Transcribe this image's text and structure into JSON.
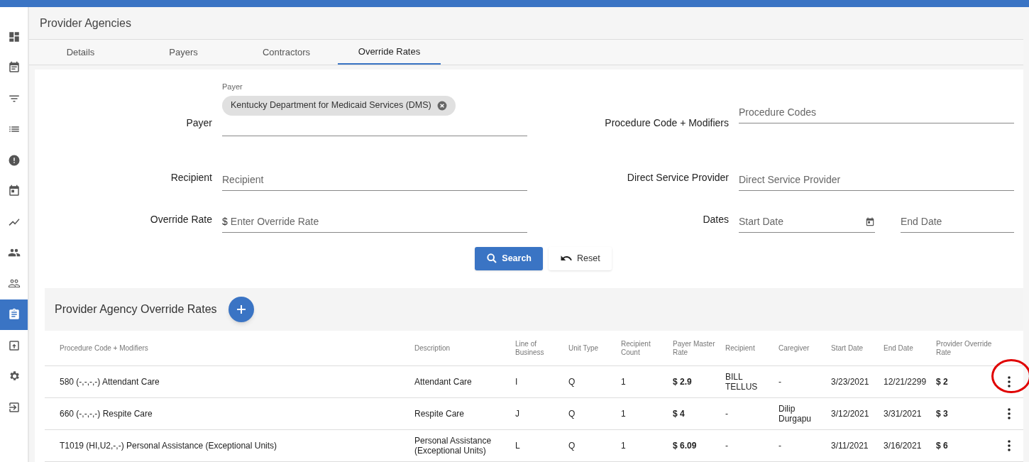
{
  "sidebar": {
    "items": [
      {
        "selected": false
      },
      {
        "selected": false
      },
      {
        "selected": false
      },
      {
        "selected": false
      },
      {
        "selected": false
      },
      {
        "selected": false
      },
      {
        "selected": false
      },
      {
        "selected": false
      },
      {
        "selected": false
      },
      {
        "selected": true
      },
      {
        "selected": false
      },
      {
        "selected": false
      },
      {
        "selected": false
      }
    ]
  },
  "page": {
    "title": "Provider Agencies"
  },
  "tabs": [
    {
      "label": "Details",
      "selected": false
    },
    {
      "label": "Payers",
      "selected": false
    },
    {
      "label": "Contractors",
      "selected": false
    },
    {
      "label": "Override Rates",
      "selected": true
    }
  ],
  "form": {
    "payer": {
      "label": "Payer",
      "floating_label": "Payer",
      "chip": "Kentucky Department for Medicaid Services (DMS)"
    },
    "procedure": {
      "label": "Procedure Code + Modifiers",
      "placeholder": "Procedure Codes"
    },
    "recipient": {
      "label": "Recipient",
      "placeholder": "Recipient"
    },
    "provider": {
      "label": "Direct Service Provider",
      "placeholder": "Direct Service Provider"
    },
    "rate": {
      "label": "Override Rate",
      "prefix": "$",
      "placeholder": "Enter Override Rate"
    },
    "dates": {
      "label": "Dates",
      "start_placeholder": "Start Date",
      "end_placeholder": "End Date"
    },
    "buttons": {
      "search": "Search",
      "reset": "Reset"
    }
  },
  "table": {
    "title": "Provider Agency Override Rates",
    "columns": [
      "Procedure Code + Modifiers",
      "Description",
      "Line of Business",
      "Unit Type",
      "Recipient Count",
      "Payer Master Rate",
      "Recipient",
      "Caregiver",
      "Start Date",
      "End Date",
      "Provider Override Rate"
    ],
    "rows": [
      {
        "highlighted": true,
        "cells": [
          "580 (-,-,-,-) Attendant Care",
          "Attendant Care",
          "I",
          "Q",
          "1",
          "$ 2.9",
          "BILL TELLUS",
          "-",
          "3/23/2021",
          "12/21/2299",
          "$ 2"
        ]
      },
      {
        "highlighted": false,
        "cells": [
          "660 (-,-,-,-) Respite Care",
          "Respite Care",
          "J",
          "Q",
          "1",
          "$ 4",
          "-",
          "Dilip Durgapu",
          "3/12/2021",
          "3/31/2021",
          "$ 3"
        ]
      },
      {
        "highlighted": false,
        "cells": [
          "T1019 (HI,U2,-,-) Personal Assistance (Exceptional Units)",
          "Personal Assistance (Exceptional Units)",
          "L",
          "Q",
          "1",
          "$ 6.09",
          "-",
          "-",
          "3/11/2021",
          "3/16/2021",
          "$ 6"
        ]
      }
    ]
  }
}
